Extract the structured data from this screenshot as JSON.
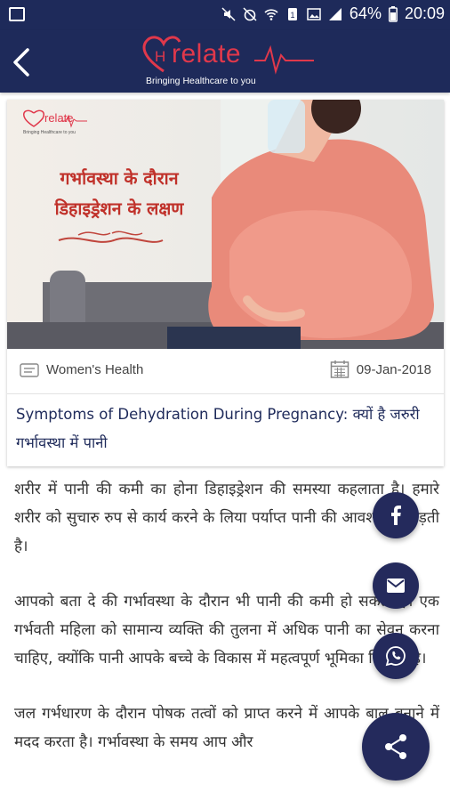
{
  "status_bar": {
    "battery": "64%",
    "time": "20:09"
  },
  "app": {
    "logo_text": "relate",
    "logo_tagline": "Bringing Healthcare to you"
  },
  "article": {
    "hero": {
      "heading_line1": "गर्भावस्था के दौरान",
      "heading_line2": "डिहाइड्रेशन के लक्षण",
      "logo_text": "relate",
      "logo_tagline": "Bringing Healthcare to you"
    },
    "category": "Women's Health",
    "date": "09-Jan-2018",
    "title": "Symptoms of Dehydration During Pregnancy: क्यों है जरुरी गर्भावस्था में पानी",
    "paragraphs": [
      "शरीर में पानी की कमी का होना डिहाइड्रेशन की समस्या कहलाता है। हमारे शरीर को सुचारु रुप से कार्य करने के लिया पर्याप्त पानी की आवश्यकता पड़ती है।",
      "आपको बता दे की गर्भावस्था के दौरान भी पानी की कमी हो सकती है। एक गर्भवती महिला को सामान्य व्यक्ति की तुलना में अधिक पानी का सेवन करना चाहिए, क्योंकि पानी आपके बच्चे के विकास में महत्वपूर्ण भूमिका निभाता है।",
      "जल गर्भधारण के दौरान पोषक तत्वों को प्राप्त करने में आपके बाल बनाने में मदद करता है। गर्भावस्था के समय आप और"
    ]
  },
  "colors": {
    "primary": "#1e2a5a",
    "accent": "#e0384b",
    "fab": "#242a5c"
  },
  "icons": {
    "share_fab": "share-icon",
    "facebook": "facebook-icon",
    "email": "email-icon",
    "whatsapp": "whatsapp-icon"
  }
}
